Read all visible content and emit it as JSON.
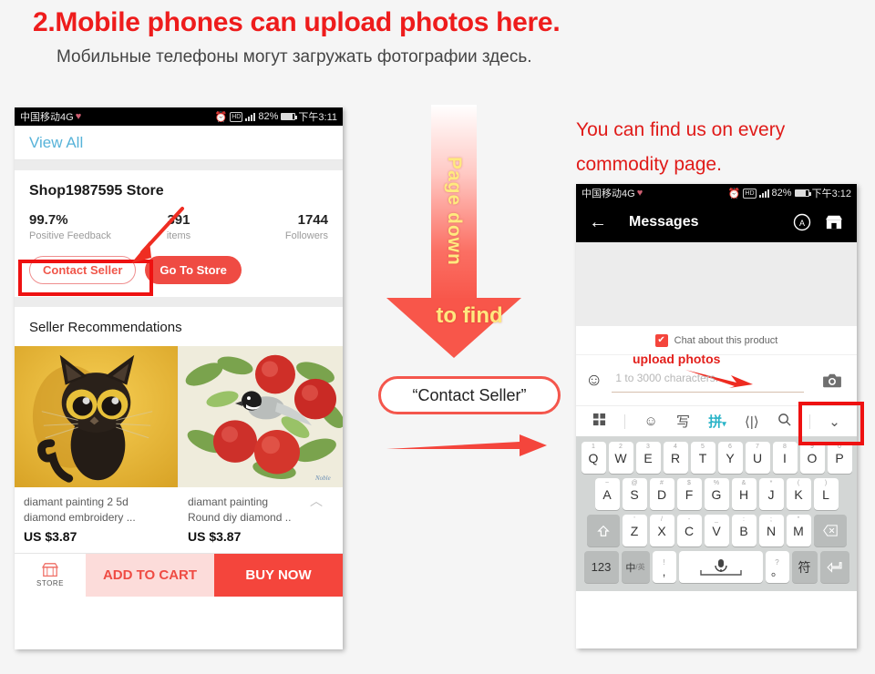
{
  "headings": {
    "english": "2.Mobile phones can upload photos here.",
    "russian": "Мобильные телефоны могут загружать фотографии здесь."
  },
  "colors": {
    "accent_red": "#ee1c1c",
    "button_red": "#ef4b43",
    "highlight_box": "#ee1111",
    "arrow_red": "#f8564a",
    "arrow_text_yellow": "#ffe97f",
    "link_blue": "#57b3d9"
  },
  "left_phone": {
    "statusbar": {
      "carrier": "中国移动4G",
      "heart_icon": "♥",
      "alarm_icon": "alarm-icon",
      "hd_badge": "HD",
      "signal_icon": "signal-bars-icon",
      "battery_percent": "82%",
      "time": "下午3:11"
    },
    "view_all": "View All",
    "store": {
      "name": "Shop1987595 Store",
      "stats": [
        {
          "value": "99.7%",
          "label": "Positive Feedback"
        },
        {
          "value": "391",
          "label": "items"
        },
        {
          "value": "1744",
          "label": "Followers"
        }
      ],
      "contact_button": "Contact Seller",
      "go_to_store_button": "Go To Store"
    },
    "recommendations_title": "Seller Recommendations",
    "products": [
      {
        "title_line1": "diamant painting 2 5d",
        "title_line2": "diamond embroidery ...",
        "price": "US $3.87",
        "image": "black-cat-painting"
      },
      {
        "title_line1": "diamant painting",
        "title_line2": "Round diy diamond ..",
        "price": "US $3.87",
        "image": "apples-and-bird-painting"
      }
    ],
    "bottom_bar": {
      "store_label": "STORE",
      "add_to_cart": "ADD TO CART",
      "buy_now": "BUY NOW"
    }
  },
  "center": {
    "arrow_label": "Page down",
    "arrow_find": "to find",
    "pill_text": "“Contact Seller”"
  },
  "right": {
    "title_line1": "You can find us on every",
    "title_line2": "commodity page.",
    "statusbar": {
      "carrier": "中国移动4G",
      "heart_icon": "♥",
      "hd_badge": "HD",
      "battery_percent": "82%",
      "time": "下午3:12"
    },
    "header": {
      "back_icon": "←",
      "title": "Messages",
      "account_icon": "A",
      "store_icon": "store-icon"
    },
    "chat_option": "Chat about this product",
    "upload_note": "upload photos",
    "input_placeholder": "1 to 3000 characters.",
    "emoji_icon": "☺",
    "camera_icon": "camera-icon",
    "keyboard": {
      "tools": [
        "grid-icon",
        "emoji-icon",
        "写",
        "拼",
        "⟨|⟩",
        "search-icon",
        "chevron-down-icon"
      ],
      "row1": [
        {
          "num": "1",
          "ch": "Q"
        },
        {
          "num": "2",
          "ch": "W"
        },
        {
          "num": "3",
          "ch": "E"
        },
        {
          "num": "4",
          "ch": "R"
        },
        {
          "num": "5",
          "ch": "T"
        },
        {
          "num": "6",
          "ch": "Y"
        },
        {
          "num": "7",
          "ch": "U"
        },
        {
          "num": "8",
          "ch": "I"
        },
        {
          "num": "9",
          "ch": "O"
        },
        {
          "num": "0",
          "ch": "P"
        }
      ],
      "row2": [
        {
          "num": "~",
          "ch": "A"
        },
        {
          "num": "@",
          "ch": "S"
        },
        {
          "num": "#",
          "ch": "D"
        },
        {
          "num": "$",
          "ch": "F"
        },
        {
          "num": "%",
          "ch": "G"
        },
        {
          "num": "&",
          "ch": "H"
        },
        {
          "num": "*",
          "ch": "J"
        },
        {
          "num": "(",
          "ch": "K"
        },
        {
          "num": ")",
          "ch": "L"
        }
      ],
      "row3": [
        {
          "num": "'",
          "ch": "Z"
        },
        {
          "num": "/",
          "ch": "X"
        },
        {
          "num": "-",
          "ch": "C"
        },
        {
          "num": "_",
          "ch": "V"
        },
        {
          "num": ":",
          "ch": "B"
        },
        {
          "num": ";",
          "ch": "N"
        },
        {
          "num": "\"",
          "ch": "M"
        }
      ],
      "shift_icon": "shift-icon",
      "backspace_icon": "backspace-icon",
      "num_key": "123",
      "lang_key": "中",
      "lang_key_sub": "/英",
      "comma_key_up": "!",
      "comma_key_down": ",",
      "space_icon": "microphone-icon",
      "period_key_up": "?",
      "period_key_down": "。",
      "symbol_key": "符",
      "enter_icon": "enter-icon"
    }
  }
}
